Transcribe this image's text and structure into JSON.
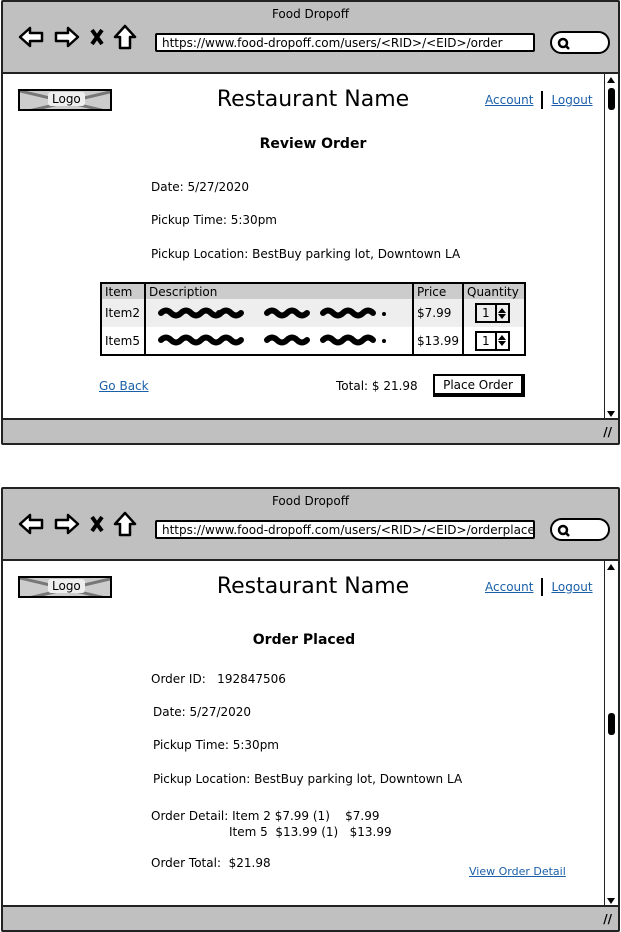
{
  "review": {
    "window_title": "Food Dropoff",
    "url": "https://www.food-dropoff.com/users/<RID>/<EID>/order",
    "logo": "Logo",
    "restaurant_name": "Restaurant Name",
    "account": "Account",
    "logout": "Logout",
    "heading": "Review Order",
    "date": "Date: 5/27/2020",
    "pickup_time": "Pickup Time: 5:30pm",
    "pickup_location": "Pickup Location: BestBuy parking lot, Downtown LA",
    "table": {
      "headers": [
        "Item",
        "Description",
        "Price",
        "Quantity"
      ],
      "rows": [
        {
          "item": "Item2",
          "price": "$7.99",
          "quantity": "1"
        },
        {
          "item": "Item5",
          "price": "$13.99",
          "quantity": "1"
        }
      ]
    },
    "go_back": "Go Back",
    "total": "Total: $ 21.98",
    "place_order": "Place Order",
    "scroll_position": 0.05
  },
  "placed": {
    "window_title": "Food Dropoff",
    "url": "https://www.food-dropoff.com/users/<RID>/<EID>/orderplaced",
    "logo": "Logo",
    "restaurant_name": "Restaurant Name",
    "account": "Account",
    "logout": "Logout",
    "heading": "Order Placed",
    "order_id": "Order ID:   192847506",
    "date": "Date: 5/27/2020",
    "pickup_time": "Pickup Time: 5:30pm",
    "pickup_location": "Pickup Location: BestBuy parking lot, Downtown LA",
    "order_detail_1": "Order Detail: Item 2 $7.99 (1)    $7.99",
    "order_detail_2": "Item 5  $13.99 (1)   $13.99",
    "order_total": "Order Total:  $21.98",
    "view_order_detail": "View Order Detail",
    "scroll_position": 0.45
  }
}
